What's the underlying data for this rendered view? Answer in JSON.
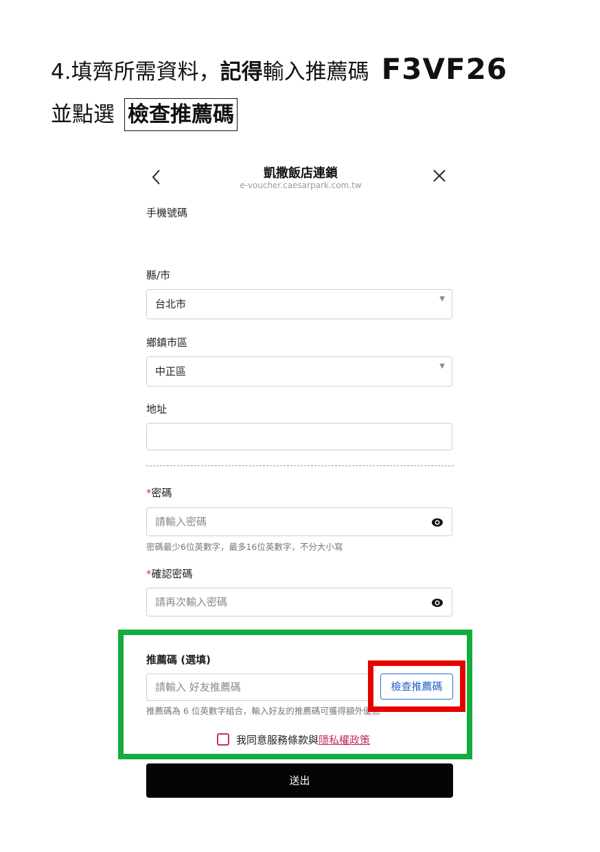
{
  "instruction": {
    "line1_prefix": "4.填齊所需資料，",
    "line1_bold": "記得",
    "line1_suffix": "輸入推薦碼",
    "code": "F3VF26",
    "line2_prefix": "並點選",
    "line2_boxed": "檢查推薦碼"
  },
  "nav": {
    "title": "凱撒飯店連鎖",
    "url": "e-voucher.caesarpark.com.tw"
  },
  "form": {
    "phone_label": "手機號碼",
    "county_label": "縣/市",
    "county_value": "台北市",
    "district_label": "鄉鎮市區",
    "district_value": "中正區",
    "address_label": "地址",
    "address_value": "",
    "password_required_mark": "*",
    "password_label": "密碼",
    "password_placeholder": "請輸入密碼",
    "password_hint": "密碼最少6位英數字，最多16位英數字，不分大小寫",
    "confirm_required_mark": "*",
    "confirm_label": "確認密碼",
    "confirm_placeholder": "請再次輸入密碼",
    "referral_label": "推薦碼 (選填)",
    "referral_placeholder": "請輸入 好友推薦碼",
    "referral_hint": "推薦碼為 6 位英數字組合，輸入好友的推薦碼可獲得額外優惠",
    "check_button": "檢查推薦碼",
    "agree_text": "我同意服務條款與",
    "privacy_link": "隱私權政策",
    "submit": "送出"
  },
  "colors": {
    "highlight_green": "#14ac3c",
    "highlight_red": "#e60000",
    "link": "#c0305a",
    "button_blue": "#1f5fbf"
  }
}
